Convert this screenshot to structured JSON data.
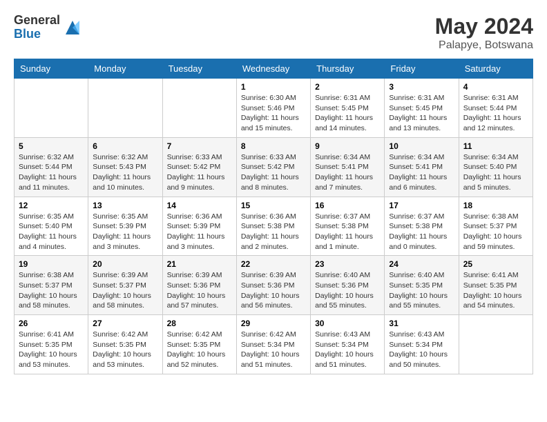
{
  "header": {
    "logo_general": "General",
    "logo_blue": "Blue",
    "month_title": "May 2024",
    "location": "Palapye, Botswana"
  },
  "days_of_week": [
    "Sunday",
    "Monday",
    "Tuesday",
    "Wednesday",
    "Thursday",
    "Friday",
    "Saturday"
  ],
  "weeks": [
    [
      {
        "day": "",
        "info": ""
      },
      {
        "day": "",
        "info": ""
      },
      {
        "day": "",
        "info": ""
      },
      {
        "day": "1",
        "info": "Sunrise: 6:30 AM\nSunset: 5:46 PM\nDaylight: 11 hours\nand 15 minutes."
      },
      {
        "day": "2",
        "info": "Sunrise: 6:31 AM\nSunset: 5:45 PM\nDaylight: 11 hours\nand 14 minutes."
      },
      {
        "day": "3",
        "info": "Sunrise: 6:31 AM\nSunset: 5:45 PM\nDaylight: 11 hours\nand 13 minutes."
      },
      {
        "day": "4",
        "info": "Sunrise: 6:31 AM\nSunset: 5:44 PM\nDaylight: 11 hours\nand 12 minutes."
      }
    ],
    [
      {
        "day": "5",
        "info": "Sunrise: 6:32 AM\nSunset: 5:44 PM\nDaylight: 11 hours\nand 11 minutes."
      },
      {
        "day": "6",
        "info": "Sunrise: 6:32 AM\nSunset: 5:43 PM\nDaylight: 11 hours\nand 10 minutes."
      },
      {
        "day": "7",
        "info": "Sunrise: 6:33 AM\nSunset: 5:42 PM\nDaylight: 11 hours\nand 9 minutes."
      },
      {
        "day": "8",
        "info": "Sunrise: 6:33 AM\nSunset: 5:42 PM\nDaylight: 11 hours\nand 8 minutes."
      },
      {
        "day": "9",
        "info": "Sunrise: 6:34 AM\nSunset: 5:41 PM\nDaylight: 11 hours\nand 7 minutes."
      },
      {
        "day": "10",
        "info": "Sunrise: 6:34 AM\nSunset: 5:41 PM\nDaylight: 11 hours\nand 6 minutes."
      },
      {
        "day": "11",
        "info": "Sunrise: 6:34 AM\nSunset: 5:40 PM\nDaylight: 11 hours\nand 5 minutes."
      }
    ],
    [
      {
        "day": "12",
        "info": "Sunrise: 6:35 AM\nSunset: 5:40 PM\nDaylight: 11 hours\nand 4 minutes."
      },
      {
        "day": "13",
        "info": "Sunrise: 6:35 AM\nSunset: 5:39 PM\nDaylight: 11 hours\nand 3 minutes."
      },
      {
        "day": "14",
        "info": "Sunrise: 6:36 AM\nSunset: 5:39 PM\nDaylight: 11 hours\nand 3 minutes."
      },
      {
        "day": "15",
        "info": "Sunrise: 6:36 AM\nSunset: 5:38 PM\nDaylight: 11 hours\nand 2 minutes."
      },
      {
        "day": "16",
        "info": "Sunrise: 6:37 AM\nSunset: 5:38 PM\nDaylight: 11 hours\nand 1 minute."
      },
      {
        "day": "17",
        "info": "Sunrise: 6:37 AM\nSunset: 5:38 PM\nDaylight: 11 hours\nand 0 minutes."
      },
      {
        "day": "18",
        "info": "Sunrise: 6:38 AM\nSunset: 5:37 PM\nDaylight: 10 hours\nand 59 minutes."
      }
    ],
    [
      {
        "day": "19",
        "info": "Sunrise: 6:38 AM\nSunset: 5:37 PM\nDaylight: 10 hours\nand 58 minutes."
      },
      {
        "day": "20",
        "info": "Sunrise: 6:39 AM\nSunset: 5:37 PM\nDaylight: 10 hours\nand 58 minutes."
      },
      {
        "day": "21",
        "info": "Sunrise: 6:39 AM\nSunset: 5:36 PM\nDaylight: 10 hours\nand 57 minutes."
      },
      {
        "day": "22",
        "info": "Sunrise: 6:39 AM\nSunset: 5:36 PM\nDaylight: 10 hours\nand 56 minutes."
      },
      {
        "day": "23",
        "info": "Sunrise: 6:40 AM\nSunset: 5:36 PM\nDaylight: 10 hours\nand 55 minutes."
      },
      {
        "day": "24",
        "info": "Sunrise: 6:40 AM\nSunset: 5:35 PM\nDaylight: 10 hours\nand 55 minutes."
      },
      {
        "day": "25",
        "info": "Sunrise: 6:41 AM\nSunset: 5:35 PM\nDaylight: 10 hours\nand 54 minutes."
      }
    ],
    [
      {
        "day": "26",
        "info": "Sunrise: 6:41 AM\nSunset: 5:35 PM\nDaylight: 10 hours\nand 53 minutes."
      },
      {
        "day": "27",
        "info": "Sunrise: 6:42 AM\nSunset: 5:35 PM\nDaylight: 10 hours\nand 53 minutes."
      },
      {
        "day": "28",
        "info": "Sunrise: 6:42 AM\nSunset: 5:35 PM\nDaylight: 10 hours\nand 52 minutes."
      },
      {
        "day": "29",
        "info": "Sunrise: 6:42 AM\nSunset: 5:34 PM\nDaylight: 10 hours\nand 51 minutes."
      },
      {
        "day": "30",
        "info": "Sunrise: 6:43 AM\nSunset: 5:34 PM\nDaylight: 10 hours\nand 51 minutes."
      },
      {
        "day": "31",
        "info": "Sunrise: 6:43 AM\nSunset: 5:34 PM\nDaylight: 10 hours\nand 50 minutes."
      },
      {
        "day": "",
        "info": ""
      }
    ]
  ]
}
